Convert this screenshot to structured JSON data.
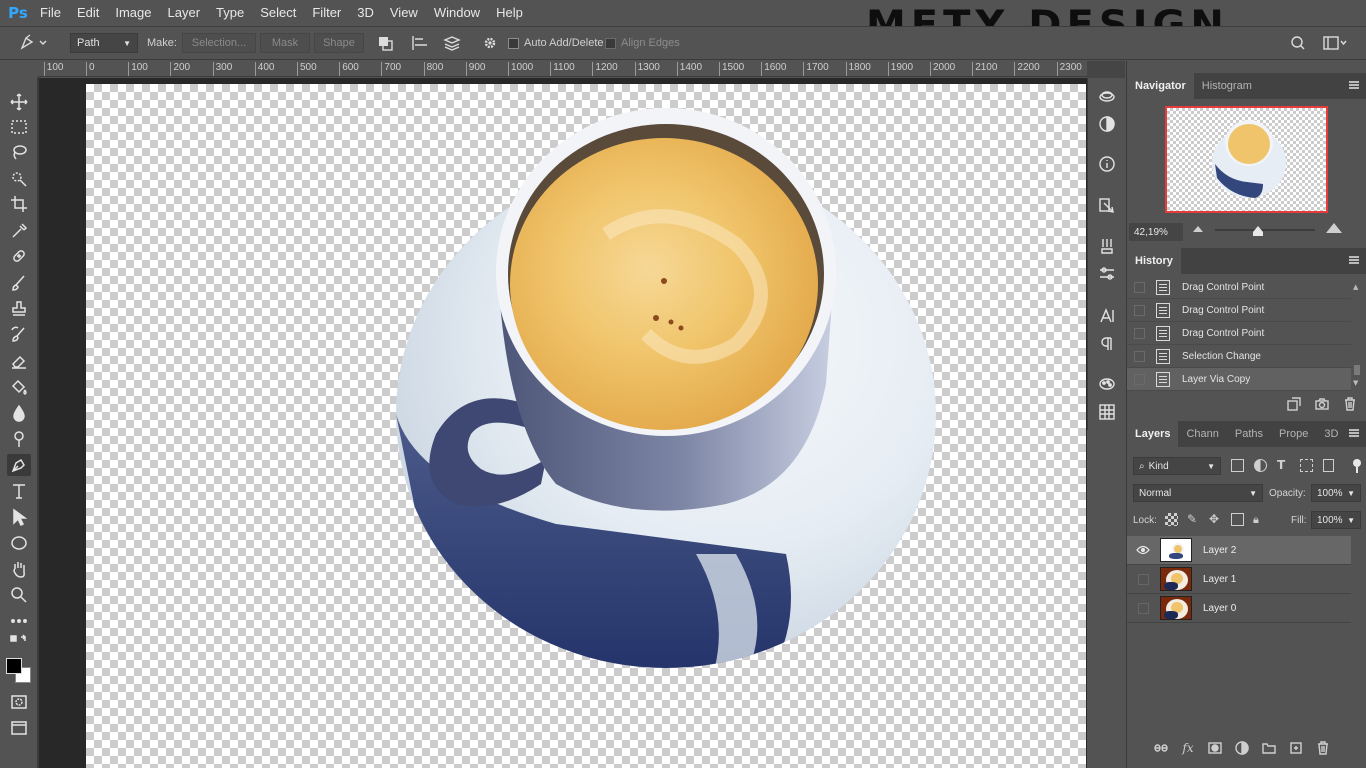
{
  "app": {
    "logo": "Ps"
  },
  "menu": [
    "File",
    "Edit",
    "Image",
    "Layer",
    "Type",
    "Select",
    "Filter",
    "3D",
    "View",
    "Window",
    "Help"
  ],
  "watermark": "METY DESIGN",
  "options": {
    "mode": "Path",
    "make_label": "Make:",
    "selection_btn": "Selection...",
    "mask_btn": "Mask",
    "shape_btn": "Shape",
    "auto_add_delete": "Auto Add/Delete",
    "align_edges": "Align Edges"
  },
  "ruler": {
    "labels": [
      "100",
      "0",
      "100",
      "200",
      "300",
      "400",
      "500",
      "600",
      "700",
      "800",
      "900",
      "1000",
      "1100",
      "1200",
      "1300",
      "1400",
      "1500",
      "1600",
      "1700",
      "1800",
      "1900",
      "2000",
      "2100",
      "2200",
      "2300"
    ]
  },
  "tools": [
    "move-tool",
    "marquee-tool",
    "lasso-tool",
    "quick-selection-tool",
    "crop-tool",
    "eyedropper-tool",
    "healing-brush-tool",
    "brush-tool",
    "clone-stamp-tool",
    "history-brush-tool",
    "eraser-tool",
    "paint-bucket-tool",
    "blur-tool",
    "dodge-tool",
    "pen-tool",
    "type-tool",
    "path-selection-tool",
    "ellipse-tool",
    "hand-tool",
    "zoom-tool",
    "more-tools",
    "color-swap",
    "color-swatches",
    "quick-mask",
    "screen-mode"
  ],
  "active_tool": "pen-tool",
  "navigator": {
    "tabs": [
      "Navigator",
      "Histogram"
    ],
    "zoom": "42,19%"
  },
  "history": {
    "tab": "History",
    "items": [
      "Drag Control Point",
      "Drag Control Point",
      "Drag Control Point",
      "Selection Change",
      "Layer Via Copy"
    ]
  },
  "layers": {
    "tabs": [
      "Layers",
      "Chann",
      "Paths",
      "Prope",
      "3D"
    ],
    "filter_kind": "Kind",
    "blend_mode": "Normal",
    "opacity_label": "Opacity:",
    "opacity": "100%",
    "lock_label": "Lock:",
    "fill_label": "Fill:",
    "fill": "100%",
    "items": [
      "Layer 2",
      "Layer 1",
      "Layer 0"
    ],
    "selected": "Layer 2"
  },
  "colors": {
    "accent_red": "#e63c3c",
    "ps_blue": "#31a8ff",
    "foam": "#f0c46a",
    "saucer_shadow": "#34477d"
  }
}
